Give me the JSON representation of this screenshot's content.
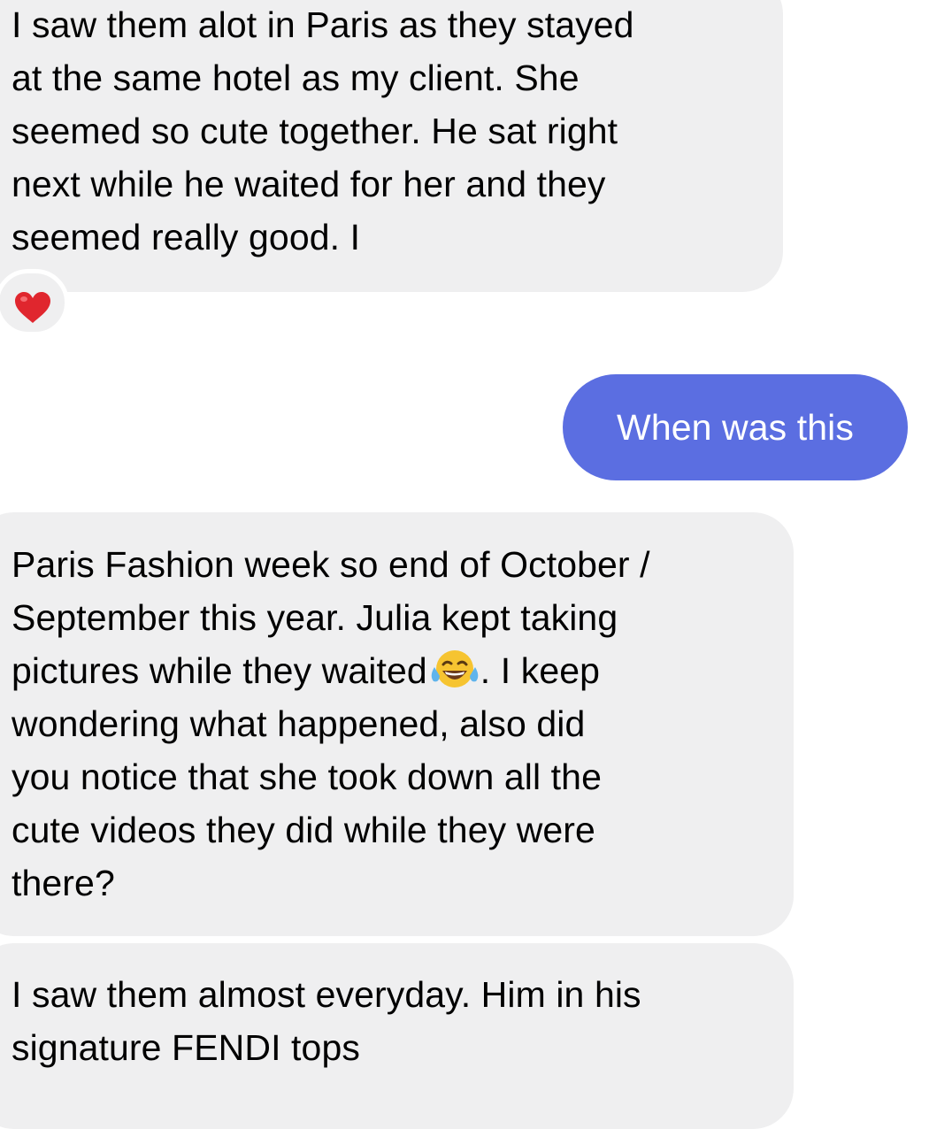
{
  "messages": [
    {
      "direction": "incoming",
      "lines": [
        "I saw them alot in Paris as they stayed",
        "at the same hotel as my client. She",
        "seemed so cute together. He sat right",
        "next while he waited for her and they",
        "seemed really good. I"
      ],
      "reaction": "heart-icon"
    },
    {
      "direction": "outgoing",
      "text": "When was this"
    },
    {
      "direction": "incoming",
      "lines": [
        "Paris Fashion week so end of October /",
        "September this year. Julia kept taking",
        "pictures while they waited",
        ". I keep",
        "wondering what happened, also did",
        "you notice that she took down all the",
        "cute videos they did while they were",
        "there?"
      ],
      "inline_emoji": "tears-of-joy-icon"
    },
    {
      "direction": "incoming",
      "lines": [
        "I saw them almost everyday. Him in his",
        "signature FENDI tops"
      ]
    }
  ],
  "colors": {
    "incoming_bubble": "#efeff0",
    "outgoing_bubble": "#5b6ee1",
    "heart": "#e0262e"
  }
}
